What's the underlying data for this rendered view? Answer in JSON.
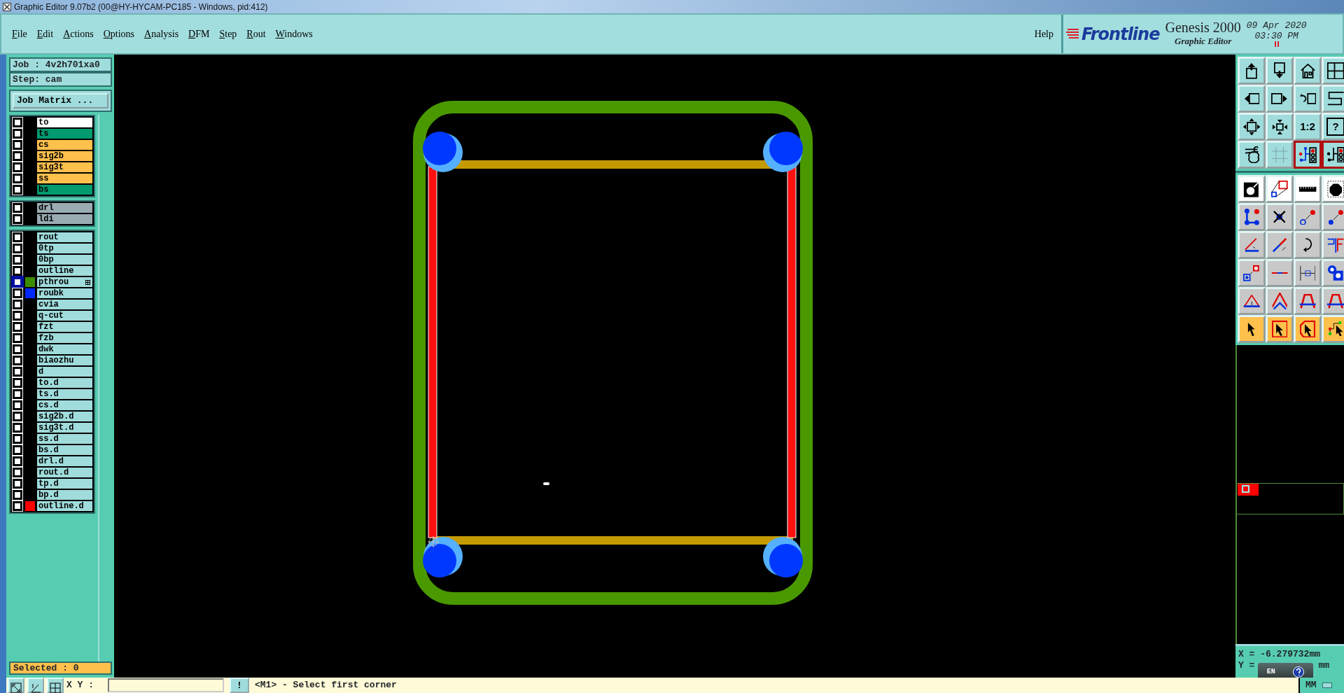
{
  "window": {
    "title": "Graphic Editor 9.07b2 (00@HY-HYCAM-PC185 - Windows, pid:412)"
  },
  "menu": [
    "File",
    "Edit",
    "Actions",
    "Options",
    "Analysis",
    "DFM",
    "Step",
    "Rout",
    "Windows"
  ],
  "help": "Help",
  "brand": {
    "logo": "Frontline",
    "product": "Genesis 2000",
    "subtitle": "Graphic Editor",
    "date": "09 Apr 2020",
    "time": "03:30 PM"
  },
  "job": {
    "job": "Job : 4v2h701xa0",
    "step": "Step: cam",
    "matrix_button": "Job Matrix ..."
  },
  "layer_groups": [
    {
      "layers": [
        {
          "name": "to",
          "color": "#ffffff",
          "highlighted": false
        },
        {
          "name": "ts",
          "color": "#009a70",
          "highlighted": false
        },
        {
          "name": "cs",
          "color": "#ffc04c",
          "highlighted": false
        },
        {
          "name": "sig2b",
          "color": "#ffc04c",
          "highlighted": false
        },
        {
          "name": "sig3t",
          "color": "#ffc04c",
          "highlighted": false
        },
        {
          "name": "ss",
          "color": "#ffc04c",
          "highlighted": false
        },
        {
          "name": "bs",
          "color": "#009a70",
          "highlighted": false
        }
      ]
    },
    {
      "layers": [
        {
          "name": "drl",
          "color": "#9aabb2",
          "highlighted": false
        },
        {
          "name": "ldi",
          "color": "#9aabb2",
          "highlighted": false
        }
      ]
    },
    {
      "layers": [
        {
          "name": "rout",
          "color": "#a0dcdc",
          "highlighted": false
        },
        {
          "name": "0tp",
          "color": "#a0dcdc",
          "highlighted": false
        },
        {
          "name": "0bp",
          "color": "#a0dcdc",
          "highlighted": false
        },
        {
          "name": "outline",
          "color": "#a0dcdc",
          "highlighted": false
        },
        {
          "name": "pthrou",
          "color": "#a0dcdc",
          "highlighted": true,
          "swatch": {
            "color": "#3c8c00"
          },
          "attributes": true
        },
        {
          "name": "roubk",
          "color": "#a0dcdc",
          "highlighted": false,
          "swatch": {
            "color": "#0028ff"
          }
        },
        {
          "name": "cvia",
          "color": "#a0dcdc",
          "highlighted": false
        },
        {
          "name": "q-cut",
          "color": "#a0dcdc",
          "highlighted": false
        },
        {
          "name": "fzt",
          "color": "#a0dcdc",
          "highlighted": false
        },
        {
          "name": "fzb",
          "color": "#a0dcdc",
          "highlighted": false
        },
        {
          "name": "dwk",
          "color": "#a0dcdc",
          "highlighted": false
        },
        {
          "name": "biaozhu",
          "color": "#a0dcdc",
          "highlighted": false
        },
        {
          "name": "d",
          "color": "#a0dcdc",
          "highlighted": false
        },
        {
          "name": "to.d",
          "color": "#a0dcdc",
          "highlighted": false
        },
        {
          "name": "ts.d",
          "color": "#a0dcdc",
          "highlighted": false
        },
        {
          "name": "cs.d",
          "color": "#a0dcdc",
          "highlighted": false
        },
        {
          "name": "sig2b.d",
          "color": "#a0dcdc",
          "highlighted": false
        },
        {
          "name": "sig3t.d",
          "color": "#a0dcdc",
          "highlighted": false
        },
        {
          "name": "ss.d",
          "color": "#a0dcdc",
          "highlighted": false
        },
        {
          "name": "bs.d",
          "color": "#a0dcdc",
          "highlighted": false
        },
        {
          "name": "drl.d",
          "color": "#a0dcdc",
          "highlighted": false
        },
        {
          "name": "rout.d",
          "color": "#a0dcdc",
          "highlighted": false
        },
        {
          "name": "tp.d",
          "color": "#a0dcdc",
          "highlighted": false
        },
        {
          "name": "bp.d",
          "color": "#a0dcdc",
          "highlighted": false
        },
        {
          "name": "outline.d",
          "color": "#a0dcdc",
          "highlighted": false,
          "swatch": {
            "color": "#ff0000"
          }
        }
      ]
    }
  ],
  "selected_count": "Selected : 0",
  "view_tools": [
    {
      "selected": false
    },
    {
      "selected": false
    },
    {
      "selected": false
    },
    {
      "selected": false
    },
    {
      "selected": false
    },
    {
      "selected": false
    },
    {
      "selected": false
    },
    {
      "selected": false
    },
    {
      "selected": false
    },
    {
      "selected": false
    },
    {
      "selected": false,
      "label": "1:2"
    },
    {
      "selected": false,
      "label": "?"
    },
    {
      "selected": false
    },
    {
      "selected": false
    },
    {
      "selected": true
    },
    {
      "selected": true
    }
  ],
  "edit_tools": [
    {
      "kind": "display"
    },
    {
      "kind": "display"
    },
    {
      "kind": "display"
    },
    {
      "kind": "display"
    },
    {
      "kind": "feature"
    },
    {
      "kind": "feature"
    },
    {
      "kind": "feature"
    },
    {
      "kind": "feature"
    },
    {
      "kind": "feature"
    },
    {
      "kind": "feature"
    },
    {
      "kind": "feature"
    },
    {
      "kind": "feature"
    },
    {
      "kind": "feature"
    },
    {
      "kind": "feature"
    },
    {
      "kind": "feature"
    },
    {
      "kind": "feature"
    },
    {
      "kind": "feature"
    },
    {
      "kind": "feature"
    },
    {
      "kind": "feature"
    },
    {
      "kind": "feature"
    },
    {
      "kind": "select"
    },
    {
      "kind": "select"
    },
    {
      "kind": "select"
    },
    {
      "kind": "select"
    }
  ],
  "coordinates": {
    "x": "X = -6.279732mm",
    "y_label": "Y =",
    "y_tail": "mm"
  },
  "ime_bar": {
    "language": "EN"
  },
  "command_line": {
    "label": "X Y :",
    "execute": "!",
    "prompt": "<M1> - Select first corner"
  },
  "units": "MM"
}
